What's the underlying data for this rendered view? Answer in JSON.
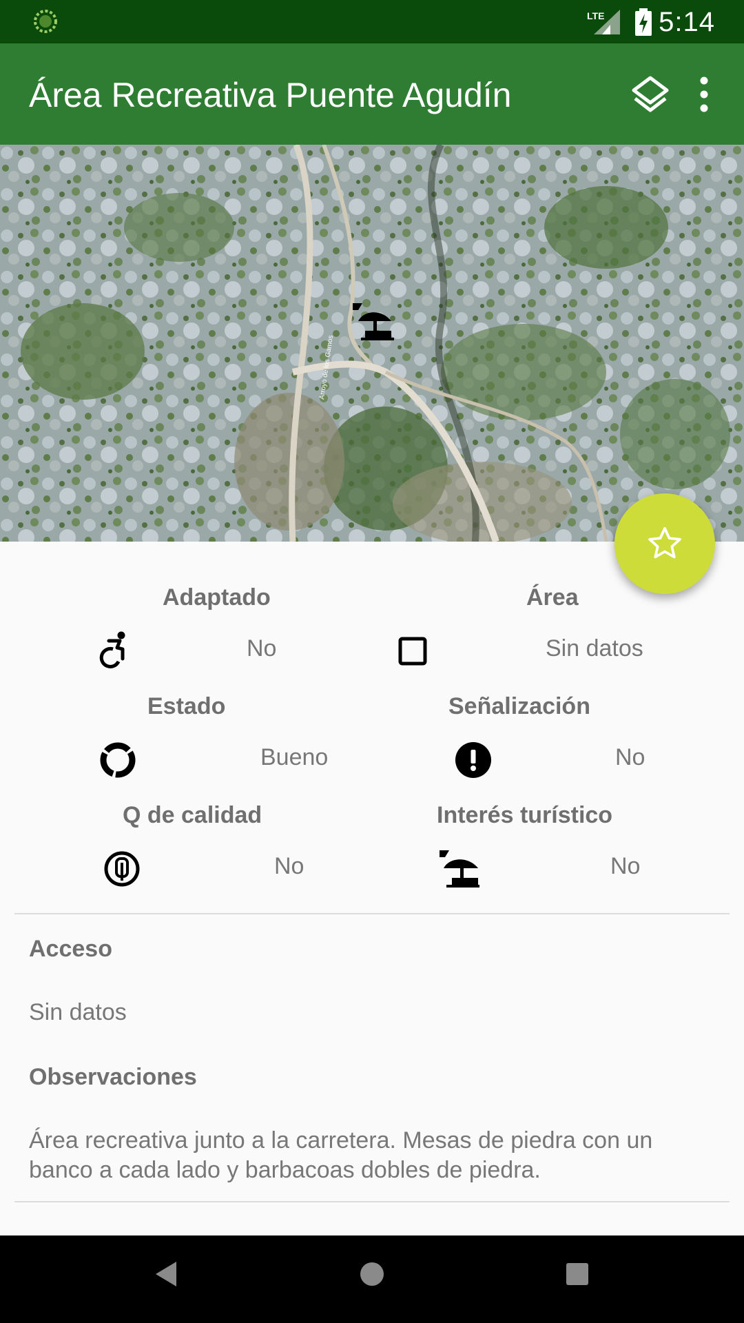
{
  "status_bar": {
    "time": "5:14",
    "network": "LTE",
    "icons": [
      "spinner-icon",
      "signal-icon",
      "battery-charging-icon"
    ]
  },
  "app_bar": {
    "title": "Área Recreativa Puente Agudín",
    "actions": [
      "layers-icon",
      "more-vert-icon"
    ]
  },
  "map": {
    "road_label": "Arroyo de los Gamos",
    "marker_icon": "picnic-area-icon"
  },
  "fab": {
    "icon": "star-outline-icon",
    "color": "#cddc39"
  },
  "attributes": [
    {
      "key": "adaptado",
      "label": "Adaptado",
      "value": "No",
      "icon": "accessible-icon"
    },
    {
      "key": "area",
      "label": "Área",
      "value": "Sin datos",
      "icon": "square-outline-icon"
    },
    {
      "key": "estado",
      "label": "Estado",
      "value": "Bueno",
      "icon": "donut-icon"
    },
    {
      "key": "senalizacion",
      "label": "Señalización",
      "value": "No",
      "icon": "alert-circle-icon"
    },
    {
      "key": "q_calidad",
      "label": "Q de calidad",
      "value": "No",
      "icon": "quality-q-icon"
    },
    {
      "key": "interes",
      "label": "Interés turístico",
      "value": "No",
      "icon": "beach-umbrella-icon"
    }
  ],
  "acceso": {
    "label": "Acceso",
    "value": "Sin datos"
  },
  "observaciones": {
    "label": "Observaciones",
    "text": "Área recreativa junto a la carretera. Mesas de piedra con un banco a cada lado y barbacoas dobles de piedra."
  },
  "colors": {
    "status_bar": "#0a4a0a",
    "app_bar": "#2e7d32",
    "fab": "#cddc39"
  },
  "nav_bar": {
    "buttons": [
      "back-icon",
      "home-icon",
      "recents-icon"
    ]
  }
}
